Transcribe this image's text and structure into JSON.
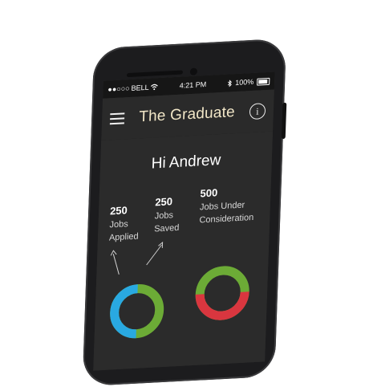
{
  "status": {
    "carrier": "BELL",
    "time": "4:21 PM",
    "battery": "100%"
  },
  "header": {
    "title": "The Graduate"
  },
  "greeting": "Hi Andrew",
  "stats": [
    {
      "value": "250",
      "label_1": "Jobs",
      "label_2": "Applied"
    },
    {
      "value": "250",
      "label_1": "Jobs",
      "label_2": "Saved"
    },
    {
      "value": "500",
      "label_1": "Jobs Under",
      "label_2": "Consideration"
    }
  ],
  "colors": {
    "ring_green": "#6cab36",
    "ring_blue": "#29a9e1",
    "ring_red": "#d9363f",
    "title": "#f2e7c8",
    "screen_bg": "#2b2b2b"
  },
  "icons": [
    "menu-icon",
    "info-icon",
    "wifi-icon",
    "bluetooth-icon",
    "battery-icon"
  ]
}
